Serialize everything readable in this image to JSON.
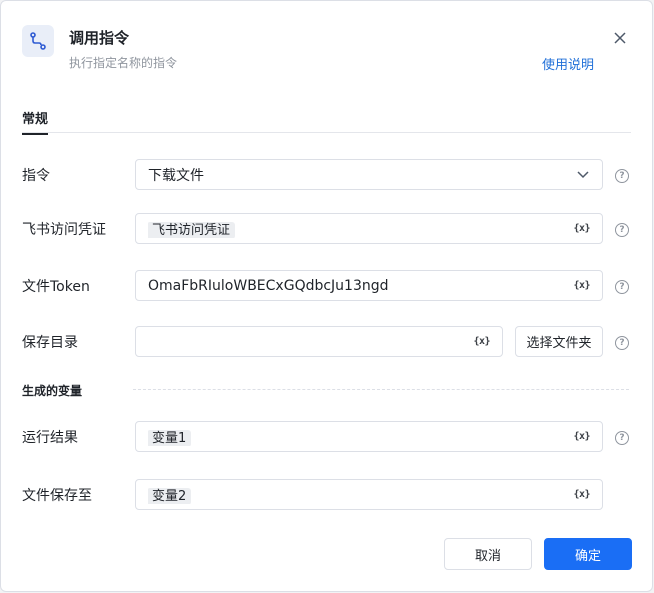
{
  "header": {
    "title": "调用指令",
    "subtitle": "执行指定名称的指令",
    "help_link": "使用说明",
    "icon": "flow-route-icon",
    "close_icon": "close-icon"
  },
  "tabs": [
    {
      "label": "常规",
      "active": true
    }
  ],
  "form": {
    "command": {
      "label": "指令",
      "value": "下载文件",
      "icon": "chevron-down-icon"
    },
    "credential": {
      "label": "飞书访问凭证",
      "value": "飞书访问凭证",
      "var_icon": "{x}"
    },
    "file_token": {
      "label": "文件Token",
      "value": "OmaFbRIuloWBECxGQdbcJu13ngd",
      "var_icon": "{x}"
    },
    "save_dir": {
      "label": "保存目录",
      "value": "",
      "var_icon": "{x}",
      "button": "选择文件夹"
    }
  },
  "generated": {
    "section_title": "生成的变量",
    "run_result": {
      "label": "运行结果",
      "value": "变量1",
      "var_icon": "{x}"
    },
    "save_to": {
      "label": "文件保存至",
      "value": "变量2",
      "var_icon": "{x}"
    }
  },
  "help_mark": "?",
  "footer": {
    "cancel": "取消",
    "ok": "确定"
  },
  "colors": {
    "primary": "#1a6ef5",
    "link": "#1f6fd8",
    "border": "#dcdfe6"
  }
}
